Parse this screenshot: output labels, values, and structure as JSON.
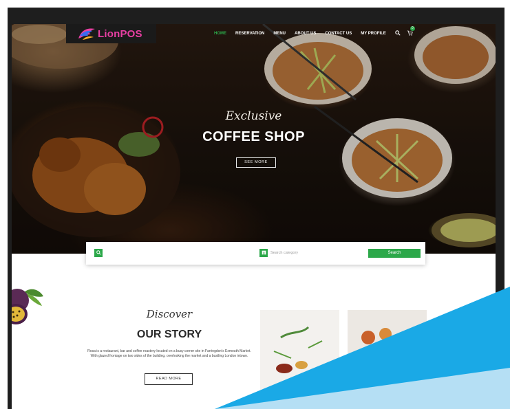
{
  "brand": {
    "logo_text": "LionPOS"
  },
  "nav": {
    "items": [
      {
        "label": "HOME",
        "active": true
      },
      {
        "label": "RESERVATION",
        "active": false
      },
      {
        "label": "MENU",
        "active": false
      },
      {
        "label": "ABOUT US",
        "active": false
      },
      {
        "label": "CONTACT US",
        "active": false
      },
      {
        "label": "MY PROFILE",
        "active": false
      }
    ],
    "search_icon": "search-icon",
    "cart_icon": "cart-icon",
    "cart_count": "0"
  },
  "hero": {
    "script": "Exclusive",
    "title": "COFFEE SHOP",
    "button": "SEE MORE"
  },
  "search": {
    "placeholder": "",
    "category_placeholder": "Search category",
    "button": "Search"
  },
  "story": {
    "script": "Discover",
    "title": "OUR STORY",
    "text": "Rosa is a restaurant, bar and coffee roastery located on a busy corner site in Farringdon's Exmouth Market. With glazed frontage on two sides of the building, overlooking the market and a bustling London intown.",
    "button": "READ MORE"
  },
  "colors": {
    "accent": "#2ca84a",
    "frame": "#1e1e1e",
    "overlay_dark": "#1aa9e6",
    "overlay_light": "#b5dff4"
  }
}
